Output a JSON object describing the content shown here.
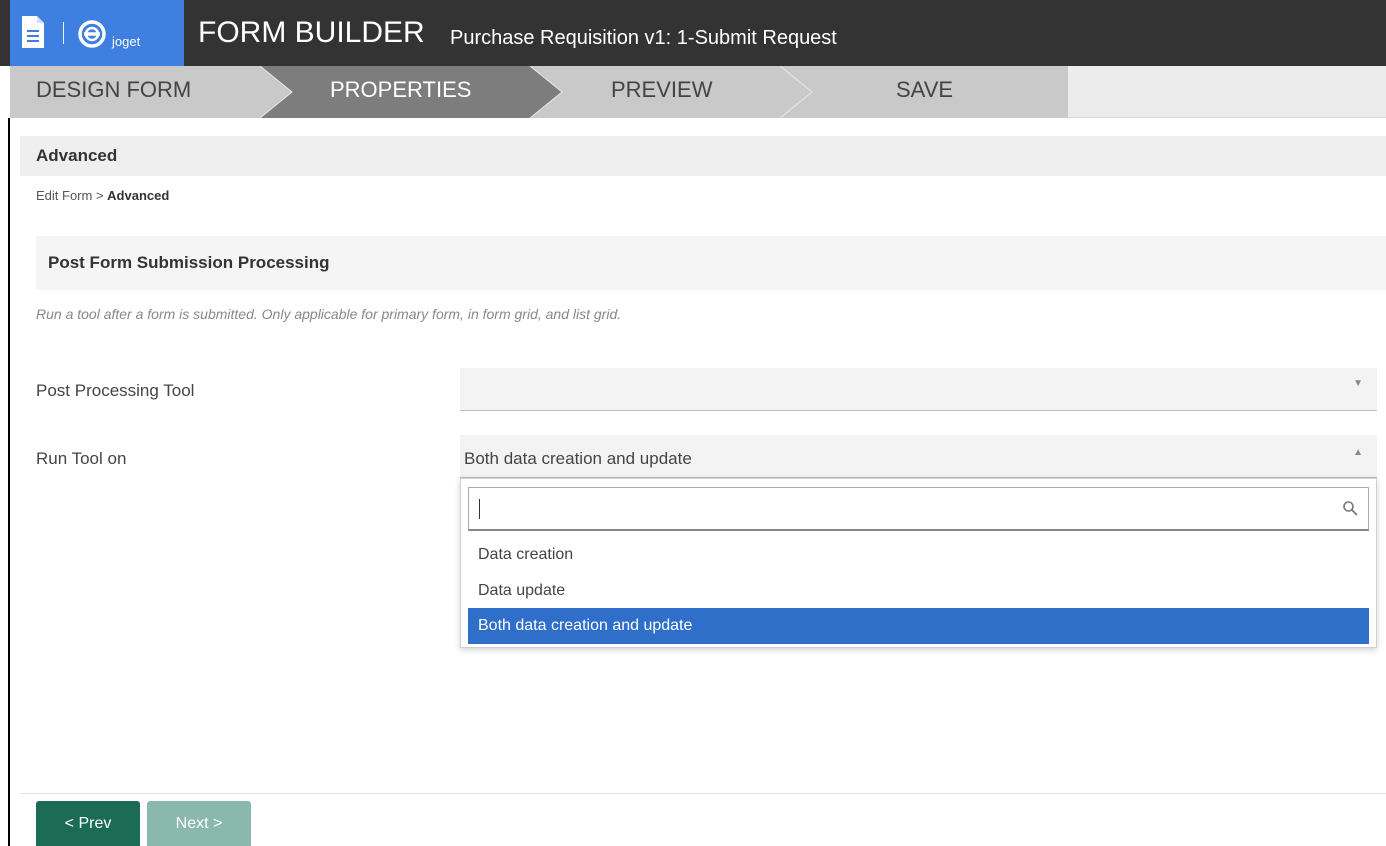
{
  "header": {
    "app_title": "FORM BUILDER",
    "subtitle": "Purchase Requisition v1: 1-Submit Request",
    "logo_text": "joget",
    "brand_color": "#3f7fe0",
    "bar_color": "#333333"
  },
  "steps": [
    {
      "label": "DESIGN FORM",
      "active": false
    },
    {
      "label": "PROPERTIES",
      "active": true
    },
    {
      "label": "PREVIEW",
      "active": false
    },
    {
      "label": "SAVE",
      "active": false
    }
  ],
  "section": {
    "title": "Advanced",
    "breadcrumb_prefix": "Edit Form >",
    "breadcrumb_current": "Advanced"
  },
  "subsection": {
    "title": "Post Form Submission Processing",
    "description": "Run a tool after a form is submitted. Only applicable for primary form, in form grid, and list grid."
  },
  "fields": {
    "post_processing_tool": {
      "label": "Post Processing Tool",
      "value": ""
    },
    "run_tool_on": {
      "label": "Run Tool on",
      "value": "Both data creation and update"
    }
  },
  "dropdown": {
    "search_value": "",
    "options": [
      "Data creation",
      "Data update",
      "Both data creation and update"
    ],
    "selected": "Both data creation and update",
    "highlight_color": "#2f6fc9"
  },
  "buttons": {
    "prev": "< Prev",
    "next": "Next >",
    "prev_color": "#1c6c55",
    "next_color": "#8bb8ad"
  }
}
